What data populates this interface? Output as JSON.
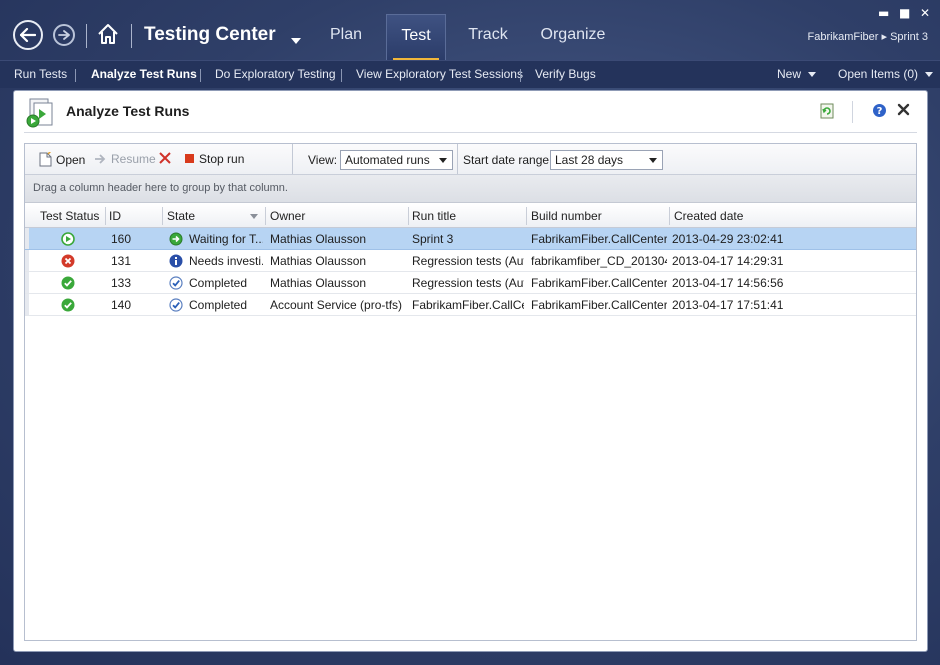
{
  "app": {
    "title": "Testing Center",
    "breadcrumb": "FabrikamFiber ▸ Sprint 3",
    "window_controls": {
      "minimize": "▬",
      "maximize": "■",
      "close": "✕"
    }
  },
  "nav": {
    "tabs": [
      {
        "label": "Plan",
        "active": false
      },
      {
        "label": "Test",
        "active": true
      },
      {
        "label": "Track",
        "active": false
      },
      {
        "label": "Organize",
        "active": false
      }
    ]
  },
  "subnav": {
    "items": [
      {
        "label": "Run Tests",
        "active": false
      },
      {
        "label": "Analyze Test Runs",
        "active": true
      },
      {
        "label": "Do Exploratory Testing",
        "active": false
      },
      {
        "label": "View Exploratory Test Sessions",
        "active": false
      },
      {
        "label": "Verify Bugs",
        "active": false
      }
    ],
    "new_label": "New",
    "open_items_label": "Open Items (0)"
  },
  "panel": {
    "title": "Analyze Test Runs"
  },
  "toolbar": {
    "open_label": "Open",
    "resume_label": "Resume",
    "stop_label": "Stop run",
    "view_label": "View:",
    "view_value": "Automated runs",
    "date_label": "Start date range:",
    "date_value": "Last 28 days"
  },
  "group_hint": "Drag a column header here to group by that column.",
  "grid": {
    "columns": [
      "Test Status",
      "ID",
      "State",
      "Owner",
      "Run title",
      "Build number",
      "Created date"
    ],
    "rows": [
      {
        "status": "in-progress",
        "id": "160",
        "state_icon": "arrow",
        "state": "Waiting for T...",
        "owner": "Mathias Olausson",
        "run_title": "Sprint 3",
        "build": "FabrikamFiber.CallCenter....",
        "created": "2013-04-29 23:02:41",
        "selected": true
      },
      {
        "status": "failed",
        "id": "131",
        "state_icon": "info",
        "state": "Needs investi...",
        "owner": "Mathias Olausson",
        "run_title": "Regression tests (Aut...",
        "build": "fabrikamfiber_CD_201304...",
        "created": "2013-04-17 14:29:31",
        "selected": false
      },
      {
        "status": "passed",
        "id": "133",
        "state_icon": "check",
        "state": "Completed",
        "owner": "Mathias Olausson",
        "run_title": "Regression tests (Aut...",
        "build": "FabrikamFiber.CallCenter....",
        "created": "2013-04-17 14:56:56",
        "selected": false
      },
      {
        "status": "passed",
        "id": "140",
        "state_icon": "check",
        "state": "Completed",
        "owner": "Account Service (pro-tfs)",
        "run_title": "FabrikamFiber.CallCe...",
        "build": "FabrikamFiber.CallCenter....",
        "created": "2013-04-17 17:51:41",
        "selected": false
      }
    ]
  },
  "colors": {
    "accent": "#f0b63a",
    "selected_row": "#b7d4f3",
    "passed": "#3aa83a",
    "failed": "#d33a2a",
    "info": "#2a4fa8"
  }
}
